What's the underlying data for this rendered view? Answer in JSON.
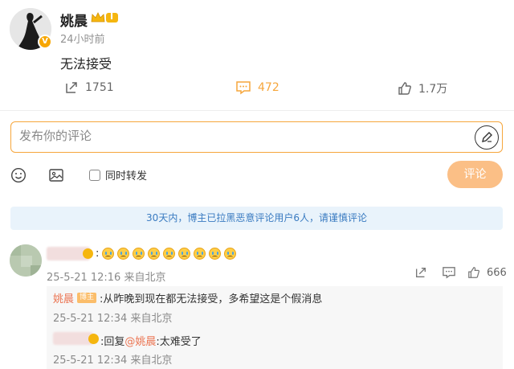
{
  "post": {
    "username": "姚晨",
    "level_badge": "I",
    "time": "24小时前",
    "text": "无法接受",
    "repost_count": "1751",
    "comment_count": "472",
    "like_count": "1.7万"
  },
  "composer": {
    "placeholder": "发布你的评论",
    "repost_checkbox_label": "同时转发",
    "send_label": "评论"
  },
  "notice": "30天内，博主已拉黑恶意评论用户6人，请谨慎评论",
  "comment": {
    "separator": ":",
    "meta": "25-5-21 12:16 来自北京",
    "like_count": "666"
  },
  "replies": [
    {
      "name": "姚晨",
      "badge": "博主",
      "text": ":从昨晚到现在都无法接受，多希望这是个假消息",
      "meta": "25-5-21 12:34 来自北京"
    },
    {
      "prefix": ":回复",
      "mention": "@姚晨",
      "text": ":太难受了",
      "meta": "25-5-21 12:34 来自北京"
    }
  ],
  "colors": {
    "accent": "#f6a63c",
    "link": "#eb7350",
    "notice_text": "#3a7bc1"
  }
}
